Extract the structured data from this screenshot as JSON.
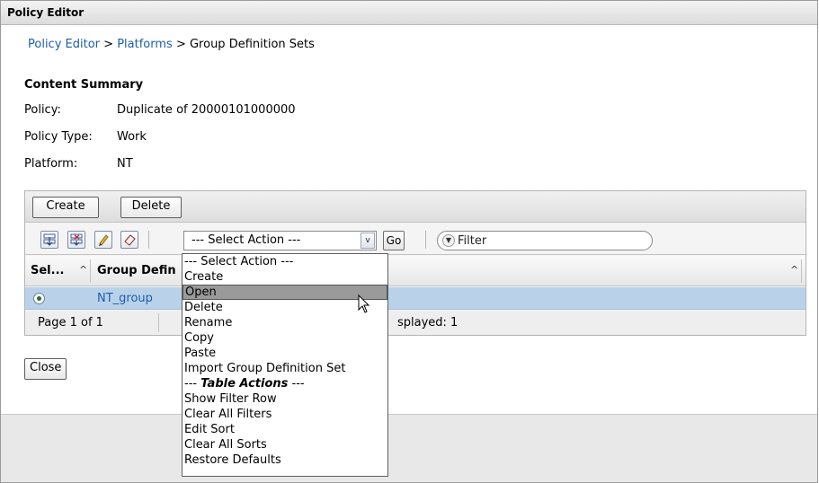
{
  "window": {
    "title": "Policy Editor"
  },
  "breadcrumb": {
    "items": [
      "Policy Editor",
      "Platforms",
      "Group Definition Sets"
    ],
    "separator": ">"
  },
  "summary": {
    "title": "Content Summary",
    "rows": [
      {
        "label": "Policy:",
        "value": "Duplicate of 20000101000000"
      },
      {
        "label": "Policy Type:",
        "value": "Work"
      },
      {
        "label": "Platform:",
        "value": "NT"
      }
    ]
  },
  "table": {
    "buttons": {
      "create": "Create",
      "delete": "Delete"
    },
    "toolbar_icons": [
      "select-all-icon",
      "deselect-all-icon",
      "edit-icon",
      "clear-icon"
    ],
    "action_select": {
      "value": "--- Select Action ---",
      "arrow": "v"
    },
    "go_label": "Go",
    "filter_placeholder": "Filter",
    "columns": [
      {
        "label": "Sel...",
        "sort": "^"
      },
      {
        "label": "Group Defin",
        "sort": "^"
      }
    ],
    "rows": [
      {
        "selected": true,
        "name": "NT_group"
      }
    ],
    "pagination": {
      "page": "Page 1 of 1",
      "displayed": "splayed: 1"
    }
  },
  "close_label": "Close",
  "action_menu": {
    "items": [
      {
        "label": "--- Select Action ---",
        "type": "item"
      },
      {
        "label": "Create",
        "type": "item"
      },
      {
        "label": "Open",
        "type": "item",
        "highlighted": true
      },
      {
        "label": "Delete",
        "type": "item"
      },
      {
        "label": "Rename",
        "type": "item"
      },
      {
        "label": "Copy",
        "type": "item"
      },
      {
        "label": "Paste",
        "type": "item"
      },
      {
        "label": "Import Group Definition Set",
        "type": "item"
      },
      {
        "label": "Table Actions",
        "type": "group",
        "dash_left": "--- ",
        "dash_right": " ---"
      },
      {
        "label": "Show Filter Row",
        "type": "item"
      },
      {
        "label": "Clear All Filters",
        "type": "item"
      },
      {
        "label": "Edit Sort",
        "type": "item"
      },
      {
        "label": "Clear All Sorts",
        "type": "item"
      },
      {
        "label": "Restore Defaults",
        "type": "item"
      }
    ]
  },
  "colors": {
    "link": "#1f5ea9",
    "selected_row": "#b9d2ea",
    "menu_highlight": "#9a9a9a"
  }
}
